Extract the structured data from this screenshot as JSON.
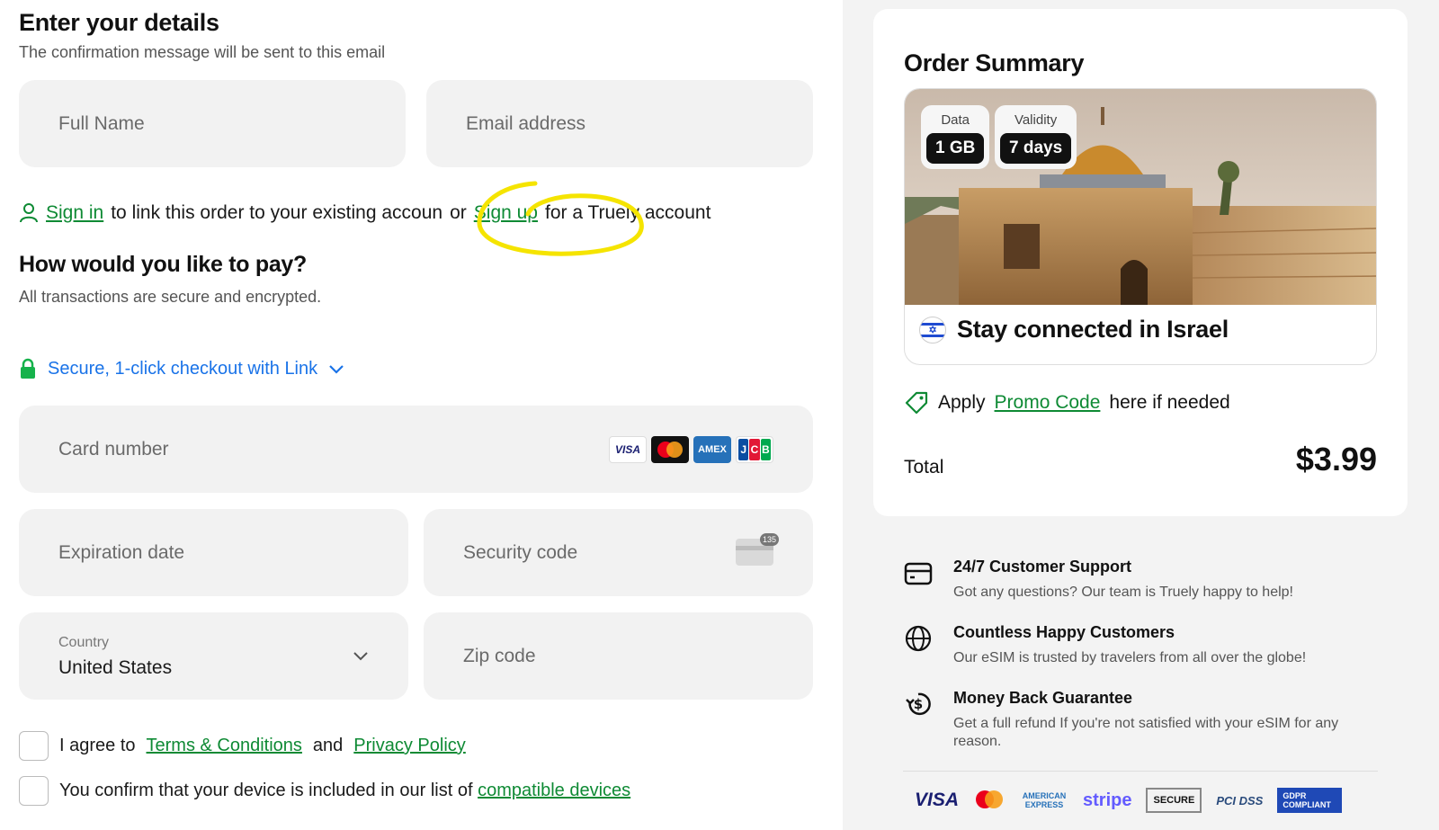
{
  "details": {
    "title": "Enter your details",
    "subtitle": "The confirmation message will be sent to this email",
    "full_name_placeholder": "Full Name",
    "email_placeholder": "Email address",
    "sign_in": "Sign in",
    "sign_in_mid": "to link this order to your existing accoun",
    "or": "or",
    "sign_up": "Sign up",
    "sign_up_tail": "for a Truely account"
  },
  "payment": {
    "title": "How would you like to pay?",
    "subtitle": "All transactions are secure and encrypted.",
    "link_checkout": "Secure, 1-click checkout with Link",
    "card_number_placeholder": "Card number",
    "card_brands": [
      "VISA",
      "Mastercard",
      "AMEX",
      "JCB"
    ],
    "expiration_placeholder": "Expiration date",
    "security_placeholder": "Security code",
    "cvc_hint": "135",
    "country_label": "Country",
    "country_value": "United States",
    "zip_placeholder": "Zip code"
  },
  "consent": {
    "agree_prefix": "I agree to",
    "terms": "Terms & Conditions",
    "and": "and",
    "privacy": "Privacy Policy",
    "device_prefix": "You confirm that your device is included in our list of",
    "compatible": "compatible devices"
  },
  "summary": {
    "title": "Order Summary",
    "data_label": "Data",
    "data_value": "1 GB",
    "validity_label": "Validity",
    "validity_value": "7 days",
    "plan_caption": "Stay connected in Israel",
    "promo_prefix": "Apply",
    "promo_link": "Promo Code",
    "promo_suffix": "here if needed",
    "total_label": "Total",
    "total_value": "$3.99"
  },
  "perks": [
    {
      "title": "24/7 Customer Support",
      "desc": "Got any questions? Our team is Truely happy to help!",
      "icon": "support-card-icon"
    },
    {
      "title": "Countless Happy Customers",
      "desc": "Our eSIM is trusted by travelers from all over the globe!",
      "icon": "globe-icon"
    },
    {
      "title": "Money Back Guarantee",
      "desc": "Get a full refund If you're not satisfied with your eSIM for any reason.",
      "icon": "money-back-icon"
    }
  ],
  "trust_badges": [
    "VISA",
    "mastercard",
    "AMERICAN EXPRESS",
    "stripe",
    "SECURE",
    "PCI DSS",
    "GDPR COMPLIANT"
  ],
  "colors": {
    "accent_green": "#0e8a34",
    "link_blue": "#1a73e8",
    "highlight": "#f5e400"
  }
}
